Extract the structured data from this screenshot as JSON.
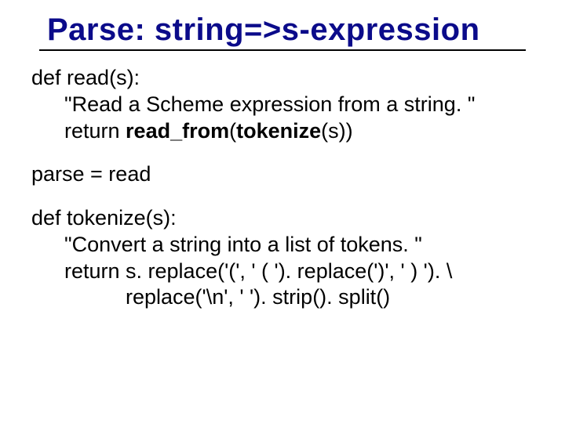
{
  "title": "Parse: string=>s-expression",
  "code": {
    "read_def": "def read(s):",
    "read_doc": "\"Read a Scheme expression from a string. \"",
    "read_ret_prefix": "return ",
    "read_ret_bold": "read_from",
    "read_ret_mid": "(",
    "read_ret_bold2": "tokenize",
    "read_ret_suffix": "(s))",
    "alias": "parse = read",
    "tok_def": "def tokenize(s):",
    "tok_doc": "\"Convert a string into a list of tokens. \"",
    "tok_ret1": "return s. replace('(', ' ( '). replace(')', ' ) '). \\",
    "tok_ret2": "replace('\\n', ' '). strip(). split()"
  }
}
